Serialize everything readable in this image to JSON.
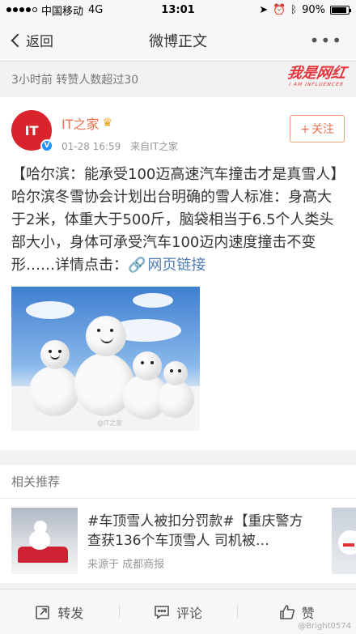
{
  "status_bar": {
    "carrier": "中国移动",
    "network": "4G",
    "time": "13:01",
    "battery": "90%",
    "battery_level": 0.9
  },
  "nav": {
    "back_label": "返回",
    "title": "微博正文",
    "more_label": "•••"
  },
  "meta_bar": {
    "text": "3小时前 转赞人数超过30",
    "stamp": "我是网红",
    "stamp_sub": "I AM INFLUENCER"
  },
  "post": {
    "avatar_text": "IT",
    "author": "IT之家",
    "date": "01-28 16:59",
    "source": "来自IT之家",
    "follow_label": "关注",
    "text": "【哈尔滨：能承受100迈高速汽车撞击才是真雪人】哈尔滨冬雪协会计划出台明确的雪人标准：身高大于2米，体重大于500斤，脑袋相当于6.5个人类头部大小，身体可承受汽车100迈内速度撞击不变形……详情点击：",
    "link_label": "网页链接",
    "image_watermark": "@IT之家"
  },
  "recommend": {
    "header": "相关推荐",
    "items": [
      {
        "title": "#车顶雪人被扣分罚款#【重庆警方查获136个车顶雪人 司机被…",
        "source": "来源于 成都商报"
      }
    ]
  },
  "toolbar": {
    "repost": "转发",
    "comment": "评论",
    "like": "赞"
  },
  "watermark": "@Bright0574"
}
